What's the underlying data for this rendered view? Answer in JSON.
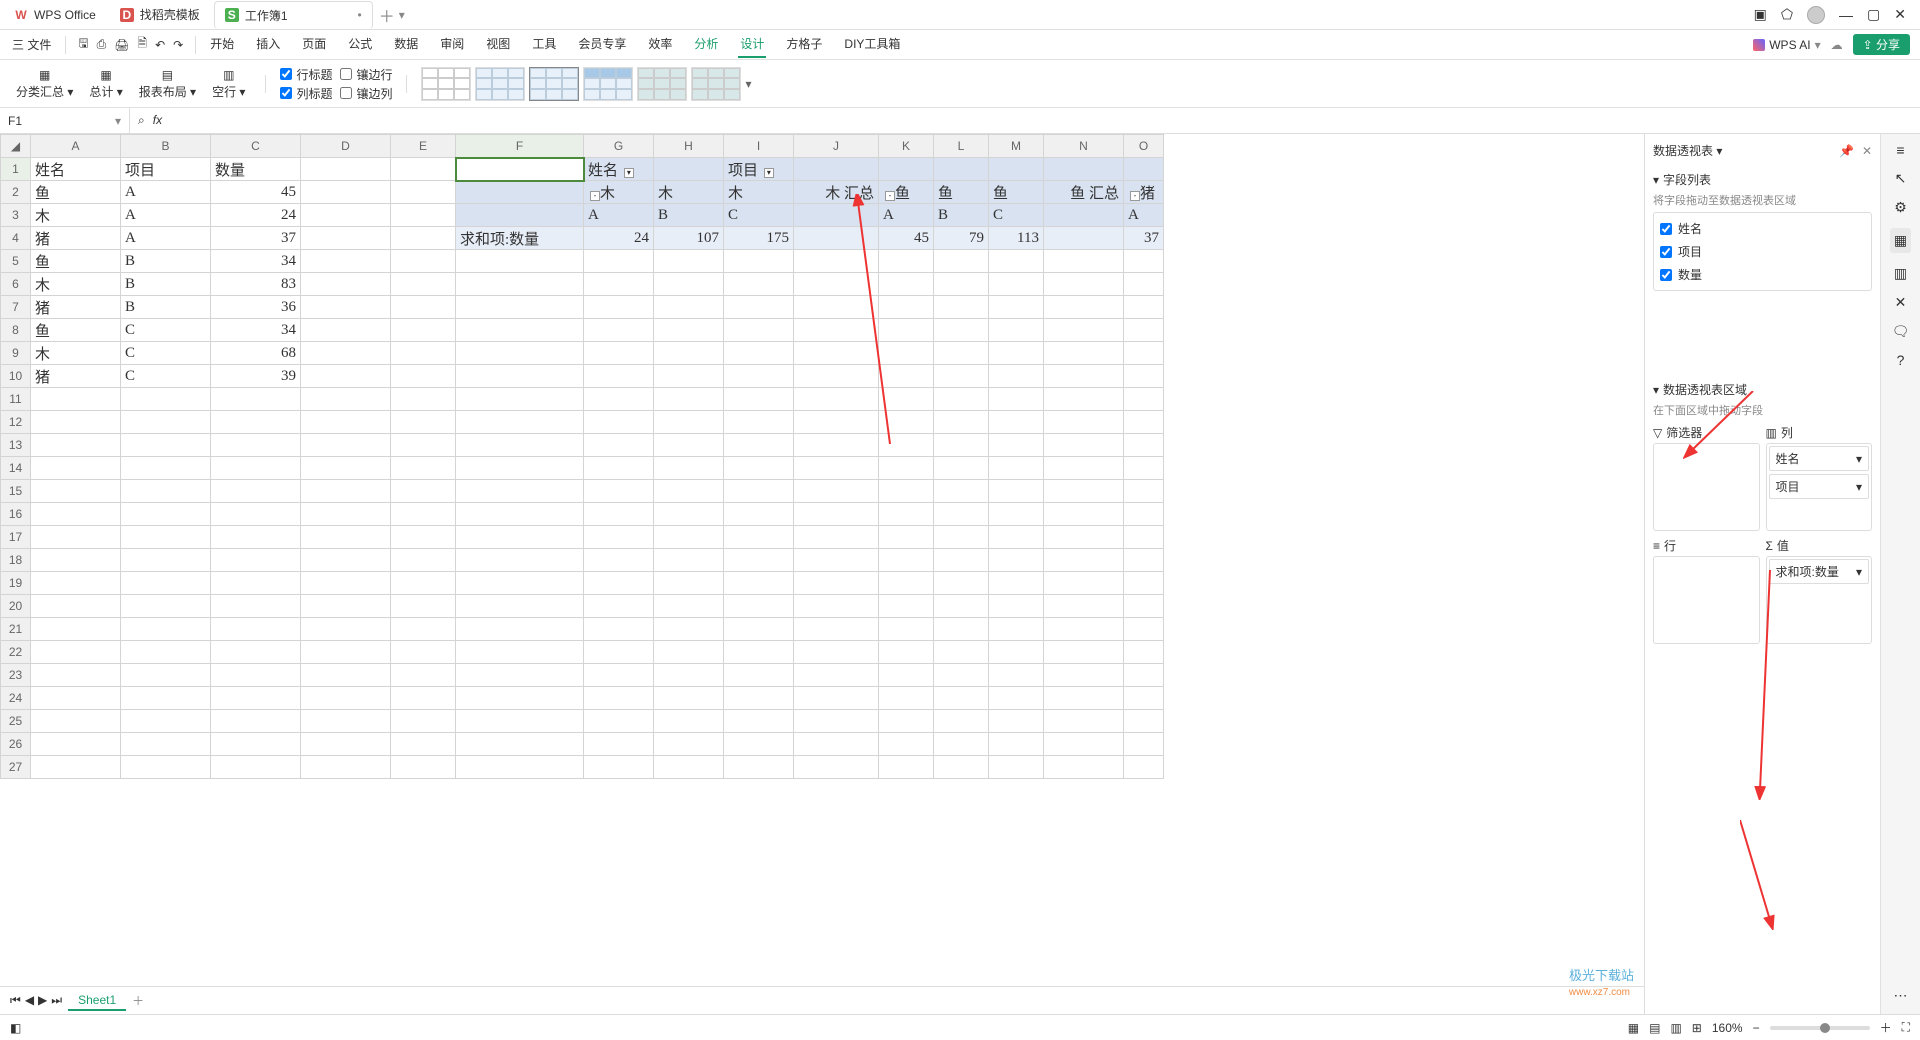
{
  "titlebar": {
    "appTab": "WPS Office",
    "templateTab": "找稻壳模板",
    "workbookTab": "工作簿1",
    "winIcons": [
      "▢",
      "⬡",
      "👤",
      "—",
      "▢",
      "✕"
    ]
  },
  "menubar": {
    "fileLabel": "三 文件",
    "menus": [
      "开始",
      "插入",
      "页面",
      "公式",
      "数据",
      "审阅",
      "视图",
      "工具",
      "会员专享",
      "效率",
      "分析",
      "设计",
      "方格子",
      "DIY工具箱"
    ],
    "activeMenu": "设计",
    "wpsAi": "WPS AI",
    "shareLabel": "⇪ 分享"
  },
  "ribbon": {
    "btnSubtotal": "分类汇总 ▾",
    "btnTotal": "总计 ▾",
    "btnLayout": "报表布局 ▾",
    "btnBlank": "空行 ▾",
    "chkRowHeader": "行标题",
    "chkColHeader": "列标题",
    "chkBandedRow": "镶边行",
    "chkBandedCol": "镶边列"
  },
  "formulaBar": {
    "nameBox": "F1"
  },
  "columns": [
    "",
    "A",
    "B",
    "C",
    "D",
    "E",
    "F",
    "G",
    "H",
    "I",
    "J",
    "K",
    "L",
    "M",
    "N",
    "O"
  ],
  "sourceData": {
    "headers": [
      "姓名",
      "项目",
      "数量"
    ],
    "rows": [
      [
        "鱼",
        "A",
        "45"
      ],
      [
        "木",
        "A",
        "24"
      ],
      [
        "猪",
        "A",
        "37"
      ],
      [
        "鱼",
        "B",
        "34"
      ],
      [
        "木",
        "B",
        "83"
      ],
      [
        "猪",
        "B",
        "36"
      ],
      [
        "鱼",
        "C",
        "34"
      ],
      [
        "木",
        "C",
        "68"
      ],
      [
        "猪",
        "C",
        "39"
      ]
    ]
  },
  "pivot": {
    "h1_G": "姓名",
    "h1_I": "项目",
    "r2_G": "木",
    "r2_H": "木",
    "r2_I": "木",
    "r2_J": "木 汇总",
    "r2_K": "鱼",
    "r2_L": "鱼",
    "r2_M": "鱼",
    "r2_N": "鱼 汇总",
    "r2_O": "猪",
    "r3_G": "A",
    "r3_H": "B",
    "r3_I": "C",
    "r3_K": "A",
    "r3_L": "B",
    "r3_M": "C",
    "r3_O": "A",
    "r4_F": "求和项:数量",
    "r4_G": "24",
    "r4_H": "107",
    "r4_I": "175",
    "r4_K": "45",
    "r4_L": "79",
    "r4_M": "113",
    "r4_O": "37"
  },
  "sheetTab": "Sheet1",
  "pivotPanel": {
    "title": "数据透视表 ▾",
    "fieldsHeader": "字段列表",
    "fieldsHint": "将字段拖动至数据透视表区域",
    "fields": [
      "姓名",
      "项目",
      "数量"
    ],
    "areasHeader": "数据透视表区域",
    "areasHint": "在下面区域中拖动字段",
    "filterLabel": "筛选器",
    "colLabel": "列",
    "rowLabel": "行",
    "valLabel": "值",
    "colItems": [
      "姓名",
      "项目"
    ],
    "valItems": [
      "求和项:数量"
    ]
  },
  "statusbar": {
    "zoom": "160%"
  },
  "watermark": "极光下载站",
  "watermark2": "www.xz7.com"
}
